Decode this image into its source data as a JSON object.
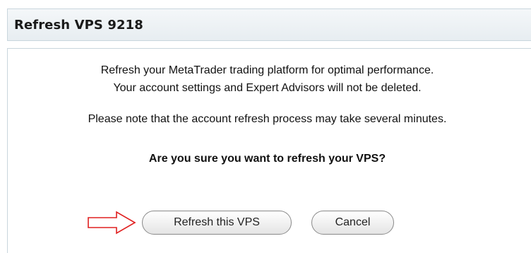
{
  "dialog": {
    "title": "Refresh VPS 9218",
    "message_line1": "Refresh your MetaTrader trading platform for optimal performance.",
    "message_line2": "Your account settings and Expert Advisors will not be deleted.",
    "note": "Please note that the account refresh process may take several minutes.",
    "question": "Are you sure you want to refresh your VPS?",
    "buttons": {
      "confirm_label": "Refresh this VPS",
      "cancel_label": "Cancel"
    }
  },
  "colors": {
    "border": "#c9d6dd",
    "header_bg": "#e7edf1",
    "arrow": "#e02020"
  },
  "icons": {
    "pointer": "right-arrow-outline-icon"
  }
}
